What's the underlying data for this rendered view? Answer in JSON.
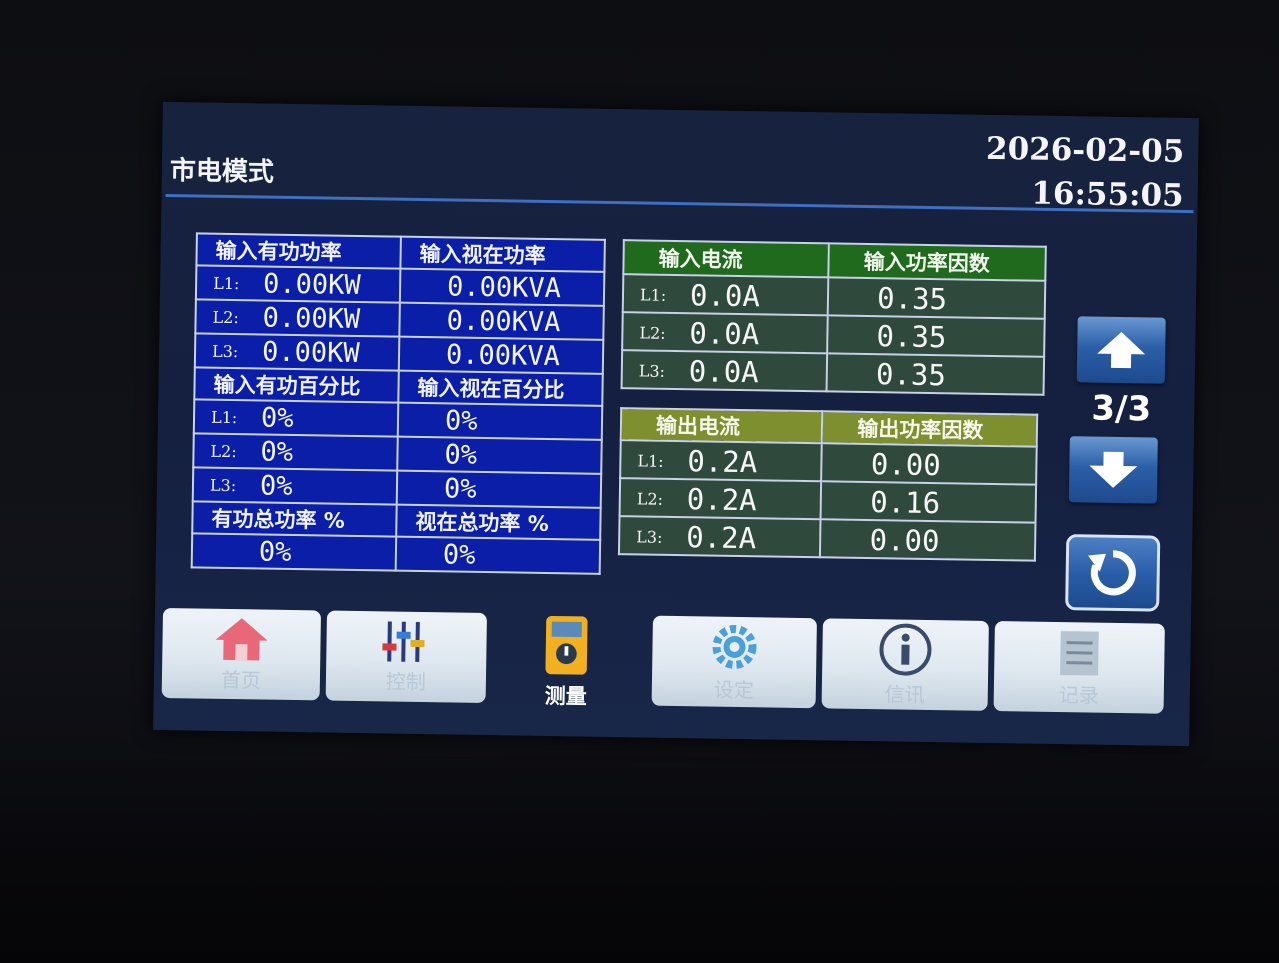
{
  "header": {
    "mode": "市电模式",
    "date": "2026-02-05",
    "time": "16:55:05"
  },
  "power_table": {
    "active_power_header": "输入有功功率",
    "apparent_power_header": "输入视在功率",
    "active_power_rows": [
      {
        "label": "L1:",
        "active": "0.00KW",
        "apparent": "0.00KVA"
      },
      {
        "label": "L2:",
        "active": "0.00KW",
        "apparent": "0.00KVA"
      },
      {
        "label": "L3:",
        "active": "0.00KW",
        "apparent": "0.00KVA"
      }
    ],
    "active_pct_header": "输入有功百分比",
    "apparent_pct_header": "输入视在百分比",
    "pct_rows": [
      {
        "label": "L1:",
        "active": "0%",
        "apparent": "0%"
      },
      {
        "label": "L2:",
        "active": "0%",
        "apparent": "0%"
      },
      {
        "label": "L3:",
        "active": "0%",
        "apparent": "0%"
      }
    ],
    "total_active_header": "有功总功率 %",
    "total_apparent_header": "视在总功率 %",
    "total_active": "0%",
    "total_apparent": "0%"
  },
  "input_table": {
    "current_header": "输入电流",
    "pf_header": "输入功率因数",
    "rows": [
      {
        "label": "L1:",
        "current": "0.0A",
        "pf": "0.35"
      },
      {
        "label": "L2:",
        "current": "0.0A",
        "pf": "0.35"
      },
      {
        "label": "L3:",
        "current": "0.0A",
        "pf": "0.35"
      }
    ]
  },
  "output_table": {
    "current_header": "输出电流",
    "pf_header": "输出功率因数",
    "rows": [
      {
        "label": "L1:",
        "current": "0.2A",
        "pf": "0.00"
      },
      {
        "label": "L2:",
        "current": "0.2A",
        "pf": "0.16"
      },
      {
        "label": "L3:",
        "current": "0.2A",
        "pf": "0.00"
      }
    ]
  },
  "pager": {
    "indicator": "3/3"
  },
  "nav": {
    "home": "首页",
    "control": "控制",
    "measure": "测量",
    "settings": "设定",
    "info": "信讯",
    "records": "记录"
  },
  "colors": {
    "blue_table": "#0a1ea8",
    "green_header": "#1f6a1c",
    "olive_header": "#7d8f2e",
    "screen_bg": "#17223e"
  }
}
